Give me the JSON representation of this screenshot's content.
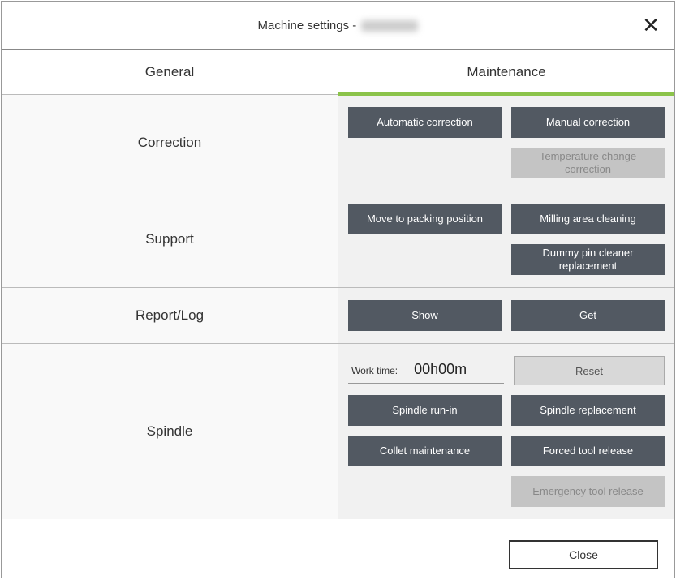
{
  "title_prefix": "Machine settings - ",
  "tabs": {
    "general": "General",
    "maintenance": "Maintenance",
    "active": "maintenance"
  },
  "sections": {
    "correction": {
      "label": "Correction",
      "automatic": "Automatic correction",
      "manual": "Manual correction",
      "temperature": "Temperature change correction"
    },
    "support": {
      "label": "Support",
      "move_packing": "Move to packing position",
      "milling_clean": "Milling area cleaning",
      "dummy_pin": "Dummy pin cleaner replacement"
    },
    "reportlog": {
      "label": "Report/Log",
      "show": "Show",
      "get": "Get"
    },
    "spindle": {
      "label": "Spindle",
      "worktime_label": "Work time:",
      "worktime_value": "00h00m",
      "reset": "Reset",
      "run_in": "Spindle run-in",
      "replacement": "Spindle replacement",
      "collet": "Collet maintenance",
      "forced_release": "Forced tool release",
      "emergency_release": "Emergency tool release"
    }
  },
  "footer": {
    "close": "Close"
  }
}
